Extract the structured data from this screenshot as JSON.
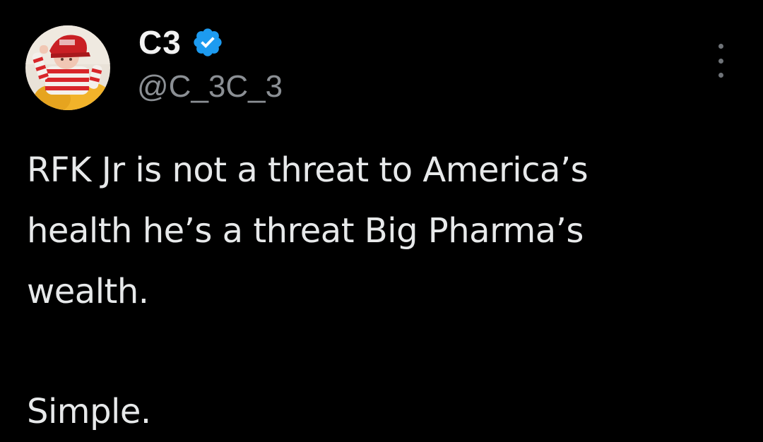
{
  "tweet": {
    "display_name": "C3",
    "handle": "@C_3C_3",
    "verified_icon": "verified-badge-icon",
    "more_icon": "more-options-icon",
    "text_lines": [
      "RFK Jr is not a threat to America’s",
      "health he’s a threat Big Pharma’s",
      "wealth."
    ],
    "text_final": "Simple."
  },
  "colors": {
    "background": "#000000",
    "text": "#e7e9ea",
    "handle": "#8b8f94",
    "verified": "#1d9bf0"
  }
}
